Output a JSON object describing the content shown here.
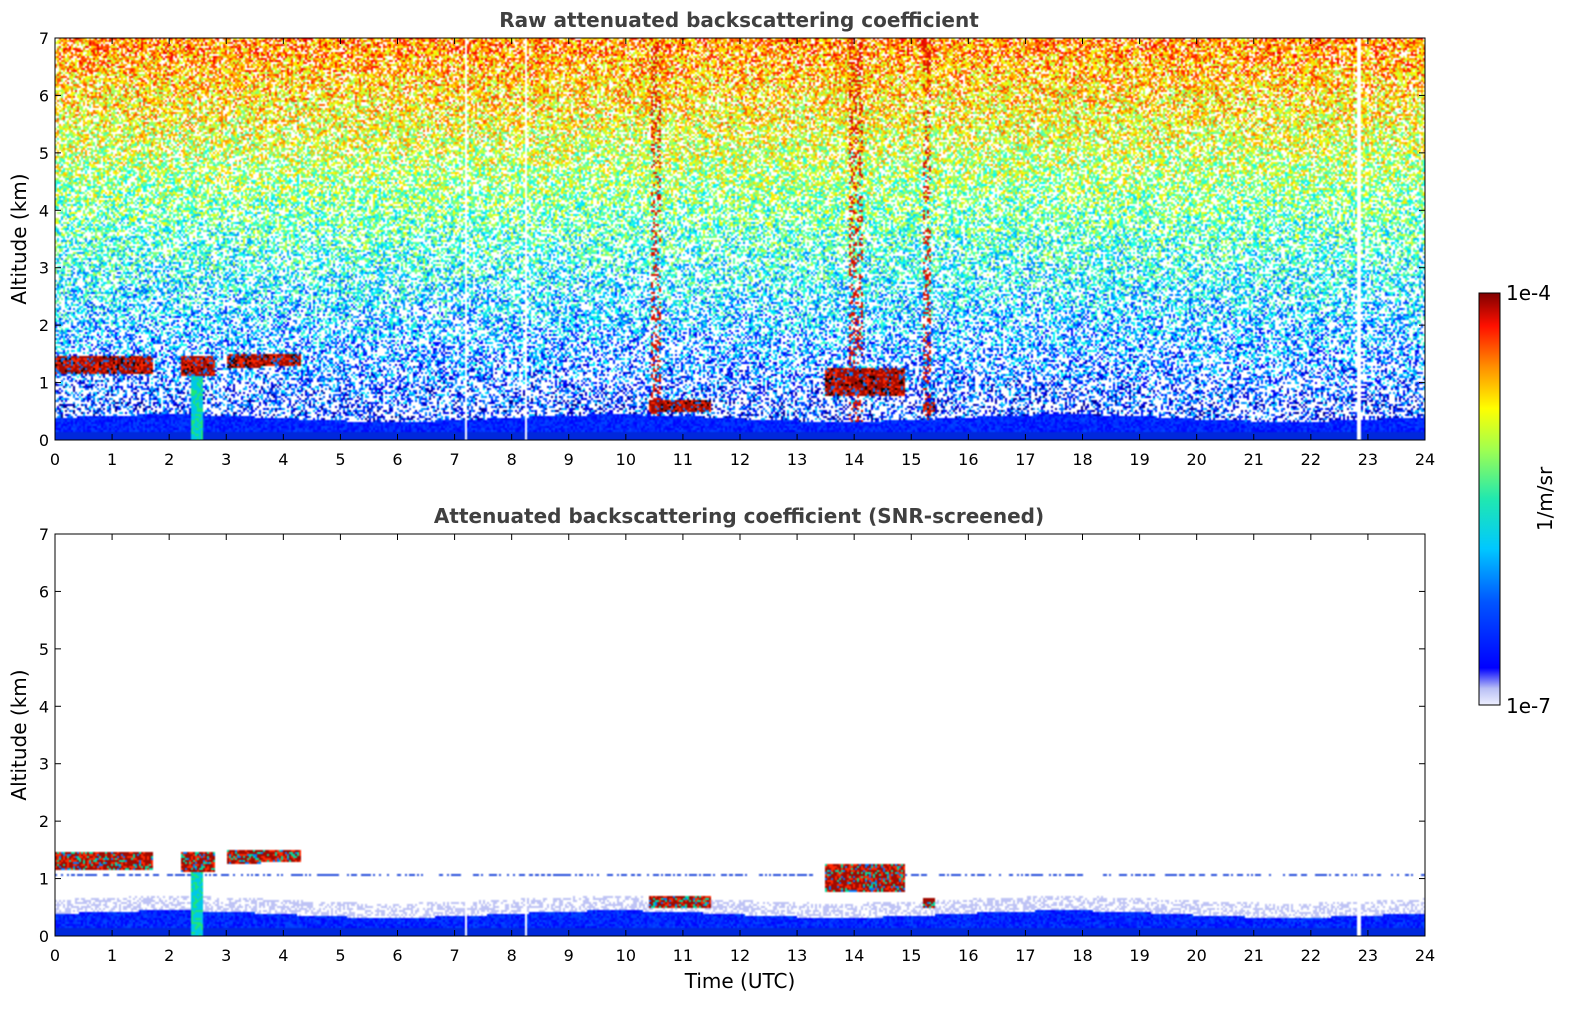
{
  "figure": {
    "shared_x": {
      "label": "Time (UTC)",
      "range": [
        0,
        24
      ],
      "ticks": [
        0,
        1,
        2,
        3,
        4,
        5,
        6,
        7,
        8,
        9,
        10,
        11,
        12,
        13,
        14,
        15,
        16,
        17,
        18,
        19,
        20,
        21,
        22,
        23,
        24
      ],
      "tick_labels": [
        "0",
        "1",
        "2",
        "3",
        "4",
        "5",
        "6",
        "7",
        "8",
        "9",
        "10",
        "11",
        "12",
        "13",
        "14",
        "15",
        "16",
        "17",
        "18",
        "19",
        "20",
        "21",
        "22",
        "23",
        "24"
      ]
    },
    "colorbar": {
      "label": "1/m/sr",
      "min_label": "1e-7",
      "max_label": "1e-4",
      "scale": "log",
      "range": [
        1e-07,
        0.0001
      ],
      "colormap": "jet"
    }
  },
  "chart_data": [
    {
      "type": "heatmap",
      "title": "Raw attenuated backscattering coefficient",
      "xlabel": "",
      "ylabel": "Altitude (km)",
      "xlim": [
        0,
        24
      ],
      "ylim": [
        0,
        7
      ],
      "yticks": [
        0,
        1,
        2,
        3,
        4,
        5,
        6,
        7
      ],
      "ytick_labels": [
        "0",
        "1",
        "2",
        "3",
        "4",
        "5",
        "6",
        "7"
      ],
      "grid": false,
      "cloud_layers": [
        {
          "t0": 0.0,
          "t1": 1.7,
          "z0": 1.15,
          "z1": 1.45
        },
        {
          "t0": 2.2,
          "t1": 2.8,
          "z0": 1.1,
          "z1": 1.45
        },
        {
          "t0": 3.0,
          "t1": 3.6,
          "z0": 1.25,
          "z1": 1.5
        },
        {
          "t0": 3.6,
          "t1": 4.3,
          "z0": 1.3,
          "z1": 1.5
        },
        {
          "t0": 10.4,
          "t1": 11.5,
          "z0": 0.5,
          "z1": 0.7
        },
        {
          "t0": 13.5,
          "t1": 14.9,
          "z0": 0.75,
          "z1": 1.25
        },
        {
          "t0": 15.2,
          "t1": 15.4,
          "z0": 0.5,
          "z1": 0.65
        }
      ],
      "precip_streak": {
        "t0": 2.4,
        "t1": 2.6,
        "z0": 0.0,
        "z1": 1.2
      },
      "data_gaps": [
        7.2,
        8.25,
        22.85
      ]
    },
    {
      "type": "heatmap",
      "title": "Attenuated backscattering coefficient (SNR-screened)",
      "xlabel": "Time (UTC)",
      "ylabel": "Altitude (km)",
      "xlim": [
        0,
        24
      ],
      "ylim": [
        0,
        7
      ],
      "yticks": [
        0,
        1,
        2,
        3,
        4,
        5,
        6,
        7
      ],
      "ytick_labels": [
        "0",
        "1",
        "2",
        "3",
        "4",
        "5",
        "6",
        "7"
      ],
      "grid": false,
      "cloud_layers": [
        {
          "t0": 0.0,
          "t1": 1.7,
          "z0": 1.15,
          "z1": 1.45
        },
        {
          "t0": 2.2,
          "t1": 2.8,
          "z0": 1.1,
          "z1": 1.45
        },
        {
          "t0": 3.0,
          "t1": 3.6,
          "z0": 1.25,
          "z1": 1.5
        },
        {
          "t0": 3.6,
          "t1": 4.3,
          "z0": 1.3,
          "z1": 1.5
        },
        {
          "t0": 10.4,
          "t1": 11.5,
          "z0": 0.5,
          "z1": 0.7
        },
        {
          "t0": 13.5,
          "t1": 14.9,
          "z0": 0.75,
          "z1": 1.25
        },
        {
          "t0": 15.2,
          "t1": 15.4,
          "z0": 0.5,
          "z1": 0.65
        }
      ],
      "precip_streak": {
        "t0": 2.4,
        "t1": 2.6,
        "z0": 0.0,
        "z1": 1.2
      },
      "artifact_line_altitude": 1.05,
      "data_gaps": [
        7.2,
        8.25,
        22.85
      ]
    }
  ]
}
